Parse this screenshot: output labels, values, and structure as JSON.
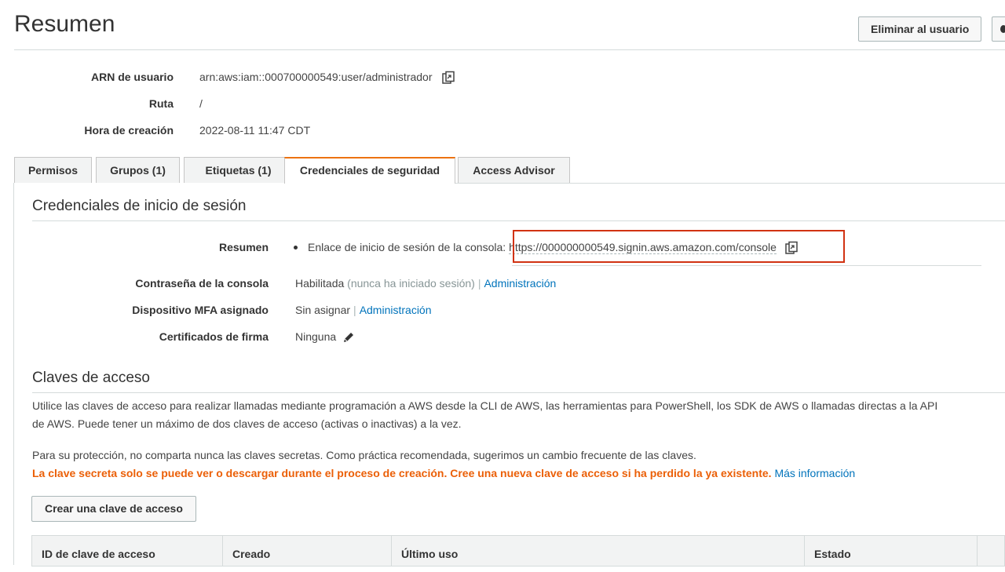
{
  "header": {
    "title": "Resumen",
    "delete_user_label": "Eliminar al usuario"
  },
  "summary": {
    "arn_label": "ARN de usuario",
    "arn_value": "arn:aws:iam::000700000549:user/administrador",
    "path_label": "Ruta",
    "path_value": "/",
    "creation_label": "Hora de creación",
    "creation_value": "2022-08-11 11:47 CDT"
  },
  "tabs": [
    {
      "label": "Permisos",
      "active": false
    },
    {
      "label": "Grupos (1)",
      "active": false
    },
    {
      "label": "Etiquetas (1)",
      "active": false
    },
    {
      "label": "Credenciales de seguridad",
      "active": true
    },
    {
      "label": "Access Advisor",
      "active": false
    }
  ],
  "signin": {
    "section_title": "Credenciales de inicio de sesión",
    "summary_label": "Resumen",
    "console_link_text": "Enlace de inicio de sesión de la consola:",
    "console_url": "https://000000000549.signin.aws.amazon.com/console",
    "password_label": "Contraseña de la consola",
    "password_status": "Habilitada",
    "password_note": "(nunca ha iniciado sesión)",
    "password_manage": "Administración",
    "mfa_label": "Dispositivo MFA asignado",
    "mfa_value": "Sin asignar",
    "mfa_manage": "Administración",
    "certs_label": "Certificados de firma",
    "certs_value": "Ninguna"
  },
  "access_keys": {
    "section_title": "Claves de acceso",
    "description_line1": "Utilice las claves de acceso para realizar llamadas mediante programación a AWS desde la CLI de AWS, las herramientas para PowerShell, los SDK de AWS o llamadas directas a la API",
    "description_line2": "de AWS. Puede tener un máximo de dos claves de acceso (activas o inactivas) a la vez.",
    "protection_text": "Para su protección, no comparta nunca las claves secretas. Como práctica recomendada, sugerimos un cambio frecuente de las claves.",
    "warning_text": "La clave secreta solo se puede ver o descargar durante el proceso de creación. Cree una nueva clave de acceso si ha perdido la ya existente.",
    "more_info_link": "Más información",
    "create_button": "Crear una clave de acceso",
    "table_headers": [
      "ID de clave de acceso",
      "Creado",
      "Último uso",
      "Estado"
    ]
  },
  "colors": {
    "accent_tab": "#ec7211",
    "link": "#0073bb",
    "warning": "#eb5f07",
    "highlight_box": "#d13212"
  },
  "icons": {
    "copy": "copy-icon",
    "edit": "pencil-icon"
  }
}
